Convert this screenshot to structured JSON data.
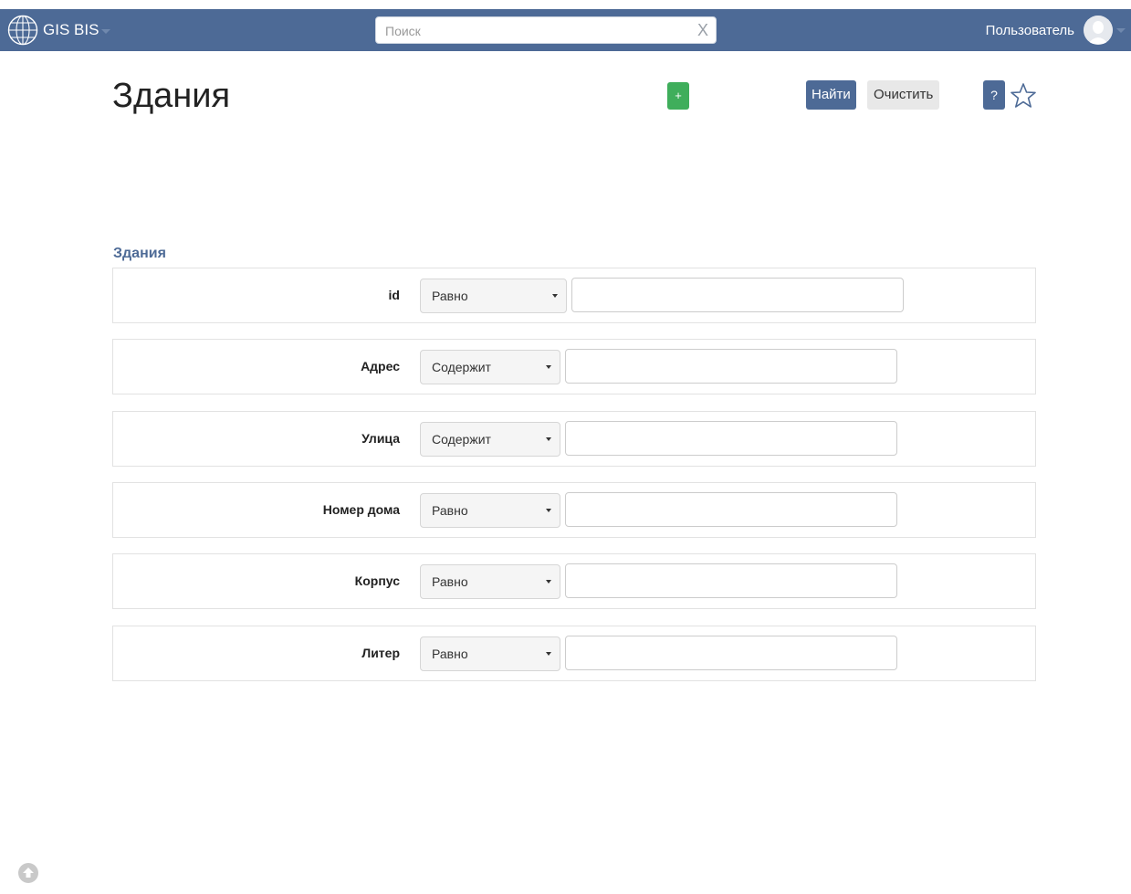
{
  "topbar": {
    "brand": "GIS BIS",
    "search_placeholder": "Поиск",
    "search_value": "",
    "search_clear": "X",
    "user_label": "Пользователь"
  },
  "page": {
    "title": "Здания"
  },
  "toolbar": {
    "add_label": "+",
    "find_label": "Найти",
    "clear_label": "Очистить",
    "help_label": "?"
  },
  "section": {
    "title": "Здания"
  },
  "filters": [
    {
      "label": "id",
      "operator": "Равно",
      "value": ""
    },
    {
      "label": "Адрес",
      "operator": "Содержит",
      "value": ""
    },
    {
      "label": "Улица",
      "operator": "Содержит",
      "value": ""
    },
    {
      "label": "Номер дома",
      "operator": "Равно",
      "value": ""
    },
    {
      "label": "Корпус",
      "operator": "Равно",
      "value": ""
    },
    {
      "label": "Литер",
      "operator": "Равно",
      "value": ""
    }
  ],
  "colors": {
    "navbar": "#4d6a96",
    "primary": "#4d6a96",
    "success": "#3fae5b"
  }
}
